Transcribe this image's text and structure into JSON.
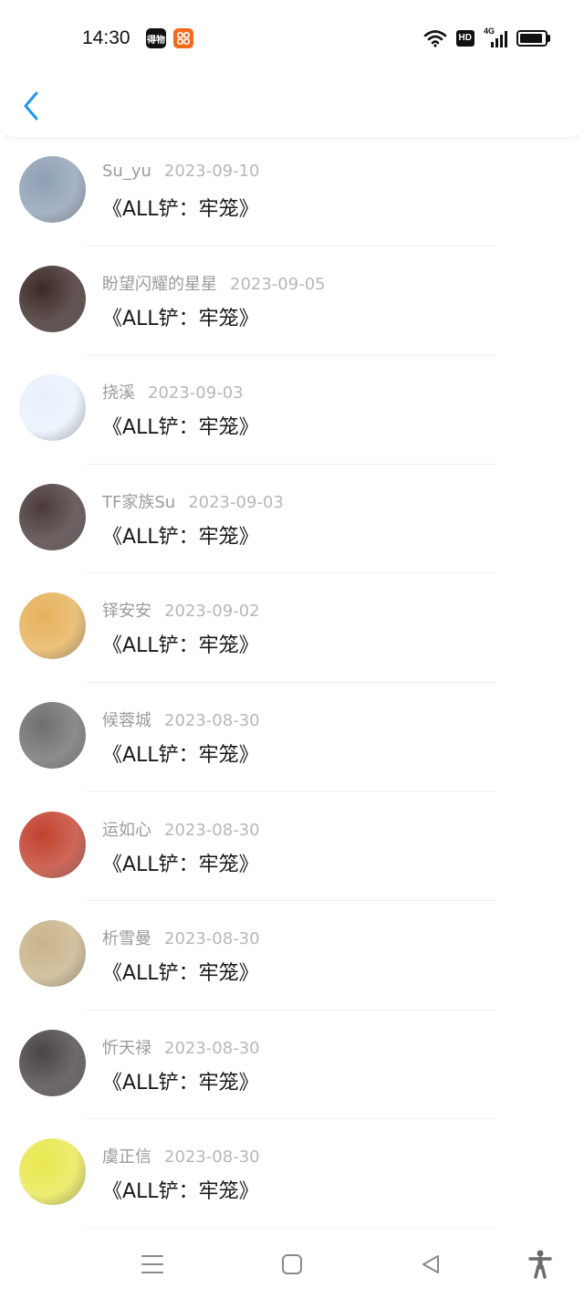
{
  "status": {
    "time": "14:30",
    "badge_app1": "得物",
    "badge_app2": "",
    "hd_label": "HD",
    "network_label": "4G",
    "battery_level": 0.92
  },
  "list": [
    {
      "name": "Su_yu",
      "date": "2023-09-10",
      "title": "《ALL铲：牢笼》",
      "avatar_hue": "#8fa0b5"
    },
    {
      "name": "盼望闪耀的星星",
      "date": "2023-09-05",
      "title": "《ALL铲：牢笼》",
      "avatar_hue": "#3b2a28"
    },
    {
      "name": "挠溪",
      "date": "2023-09-03",
      "title": "《ALL铲：牢笼》",
      "avatar_hue": "#e8f1fb"
    },
    {
      "name": "TF家族Su",
      "date": "2023-09-03",
      "title": "《ALL铲：牢笼》",
      "avatar_hue": "#4a3a3b"
    },
    {
      "name": "铎安安",
      "date": "2023-09-02",
      "title": "《ALL铲：牢笼》",
      "avatar_hue": "#e6b15b"
    },
    {
      "name": "候蓉城",
      "date": "2023-08-30",
      "title": "《ALL铲：牢笼》",
      "avatar_hue": "#6f6f72"
    },
    {
      "name": "运如心",
      "date": "2023-08-30",
      "title": "《ALL铲：牢笼》",
      "avatar_hue": "#c2412f"
    },
    {
      "name": "析雪曼",
      "date": "2023-08-30",
      "title": "《ALL铲：牢笼》",
      "avatar_hue": "#c8b38a"
    },
    {
      "name": "忻天禄",
      "date": "2023-08-30",
      "title": "《ALL铲：牢笼》",
      "avatar_hue": "#4a4445"
    },
    {
      "name": "虞正信",
      "date": "2023-08-30",
      "title": "《ALL铲：牢笼》",
      "avatar_hue": "#e9e84f"
    }
  ],
  "colors": {
    "accent": "#2196f3",
    "name_text": "#9b9b9b",
    "date_text": "#b7b7b7",
    "title_text": "#1a1a1a"
  },
  "icons": {
    "back": "chevron-left-icon",
    "menu": "menu-icon",
    "home": "home-icon",
    "back_nav": "back-triangle-icon",
    "accessibility": "accessibility-icon"
  }
}
